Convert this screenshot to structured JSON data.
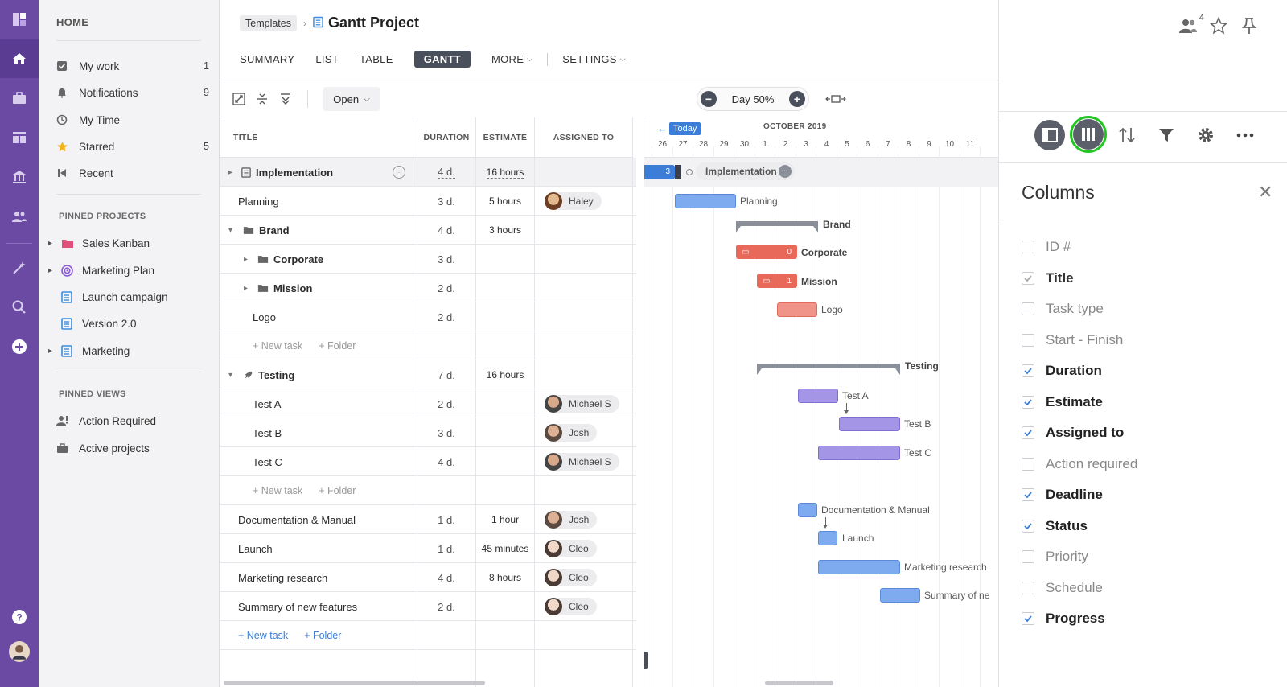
{
  "sidebar": {
    "home": "HOME",
    "nav": [
      {
        "label": "My work",
        "count": "1",
        "icon": "checkbox-icon"
      },
      {
        "label": "Notifications",
        "count": "9",
        "icon": "bell-icon"
      },
      {
        "label": "My Time",
        "count": "",
        "icon": "clock-icon"
      },
      {
        "label": "Starred",
        "count": "5",
        "icon": "star-icon"
      },
      {
        "label": "Recent",
        "count": "",
        "icon": "recent-icon"
      }
    ],
    "pinned_projects_label": "PINNED PROJECTS",
    "pinned_projects": [
      {
        "label": "Sales Kanban",
        "icon": "folder-icon",
        "color": "#e0507a"
      },
      {
        "label": "Marketing Plan",
        "icon": "target-icon",
        "color": "#8a5ad6"
      },
      {
        "label": "Launch campaign",
        "icon": "list-icon",
        "color": "#3b8ee0"
      },
      {
        "label": "Version 2.0",
        "icon": "list-icon",
        "color": "#3b8ee0"
      },
      {
        "label": "Marketing",
        "icon": "list-icon",
        "color": "#3b8ee0"
      }
    ],
    "pinned_views_label": "PINNED VIEWS",
    "pinned_views": [
      {
        "label": "Action Required",
        "icon": "person-alert-icon"
      },
      {
        "label": "Active projects",
        "icon": "briefcase-icon"
      }
    ]
  },
  "header": {
    "breadcrumb": "Templates",
    "title": "Gantt Project",
    "tabs": [
      "SUMMARY",
      "LIST",
      "TABLE",
      "GANTT",
      "MORE",
      "SETTINGS"
    ],
    "active_tab": "GANTT"
  },
  "toolbar": {
    "open_label": "Open",
    "zoom_label": "Day 50%",
    "zoom_minus": "−",
    "zoom_plus": "+"
  },
  "grid": {
    "columns": [
      "TITLE",
      "DURATION",
      "ESTIMATE",
      "ASSIGNED TO"
    ],
    "rows": [
      {
        "title": "Implementation",
        "duration": "4 d.",
        "estimate": "16 hours",
        "assignee": ""
      },
      {
        "title": "Planning",
        "duration": "3 d.",
        "estimate": "5 hours",
        "assignee": "Haley"
      },
      {
        "title": "Brand",
        "duration": "4 d.",
        "estimate": "3 hours",
        "assignee": ""
      },
      {
        "title": "Corporate",
        "duration": "3 d.",
        "estimate": "",
        "assignee": ""
      },
      {
        "title": "Mission",
        "duration": "2 d.",
        "estimate": "",
        "assignee": ""
      },
      {
        "title": "Logo",
        "duration": "2 d.",
        "estimate": "",
        "assignee": ""
      },
      {
        "new_task": "+ New task",
        "new_folder": "+ Folder"
      },
      {
        "title": "Testing",
        "duration": "7 d.",
        "estimate": "16 hours",
        "assignee": ""
      },
      {
        "title": "Test A",
        "duration": "2 d.",
        "estimate": "",
        "assignee": "Michael S"
      },
      {
        "title": "Test B",
        "duration": "3 d.",
        "estimate": "",
        "assignee": "Josh"
      },
      {
        "title": "Test C",
        "duration": "4 d.",
        "estimate": "",
        "assignee": "Michael S"
      },
      {
        "new_task": "+ New task",
        "new_folder": "+ Folder"
      },
      {
        "title": "Documentation & Manual",
        "duration": "1 d.",
        "estimate": "1 hour",
        "assignee": "Josh"
      },
      {
        "title": "Launch",
        "duration": "1 d.",
        "estimate": "45 minutes",
        "assignee": "Cleo"
      },
      {
        "title": "Marketing research",
        "duration": "4 d.",
        "estimate": "8 hours",
        "assignee": "Cleo"
      },
      {
        "title": "Summary of new features",
        "duration": "2 d.",
        "estimate": "",
        "assignee": "Cleo"
      },
      {
        "new_task": "+ New task",
        "new_folder": "+ Folder"
      }
    ]
  },
  "gantt": {
    "today_label": "Today",
    "month": "OCTOBER 2019",
    "days": [
      "5",
      "26",
      "27",
      "28",
      "29",
      "30",
      "1",
      "2",
      "3",
      "4",
      "5",
      "6",
      "7",
      "8",
      "9",
      "10",
      "11"
    ],
    "impl_count": "3",
    "corporate_count": "0",
    "mission_count": "1",
    "bar_labels": {
      "implementation": "Implementation",
      "planning": "Planning",
      "brand": "Brand",
      "corporate": "Corporate",
      "mission": "Mission",
      "logo": "Logo",
      "testing": "Testing",
      "test_a": "Test A",
      "test_b": "Test B",
      "test_c": "Test C",
      "docs": "Documentation & Manual",
      "launch": "Launch",
      "research": "Marketing research",
      "summary": "Summary of ne"
    },
    "colors": {
      "blue": "#7eaaf0",
      "red": "#e8685a",
      "purple": "#a495e6",
      "gray": "#8a8f99"
    }
  },
  "right_panel": {
    "followers_count": "4",
    "title": "Columns",
    "columns": [
      {
        "label": "ID #",
        "checked": false
      },
      {
        "label": "Title",
        "checked": true,
        "locked": true
      },
      {
        "label": "Task type",
        "checked": false
      },
      {
        "label": "Start - Finish",
        "checked": false
      },
      {
        "label": "Duration",
        "checked": true
      },
      {
        "label": "Estimate",
        "checked": true
      },
      {
        "label": "Assigned to",
        "checked": true
      },
      {
        "label": "Action required",
        "checked": false
      },
      {
        "label": "Deadline",
        "checked": true
      },
      {
        "label": "Status",
        "checked": true
      },
      {
        "label": "Priority",
        "checked": false
      },
      {
        "label": "Schedule",
        "checked": false
      },
      {
        "label": "Progress",
        "checked": true
      }
    ],
    "highlight_color": "#22c522"
  }
}
